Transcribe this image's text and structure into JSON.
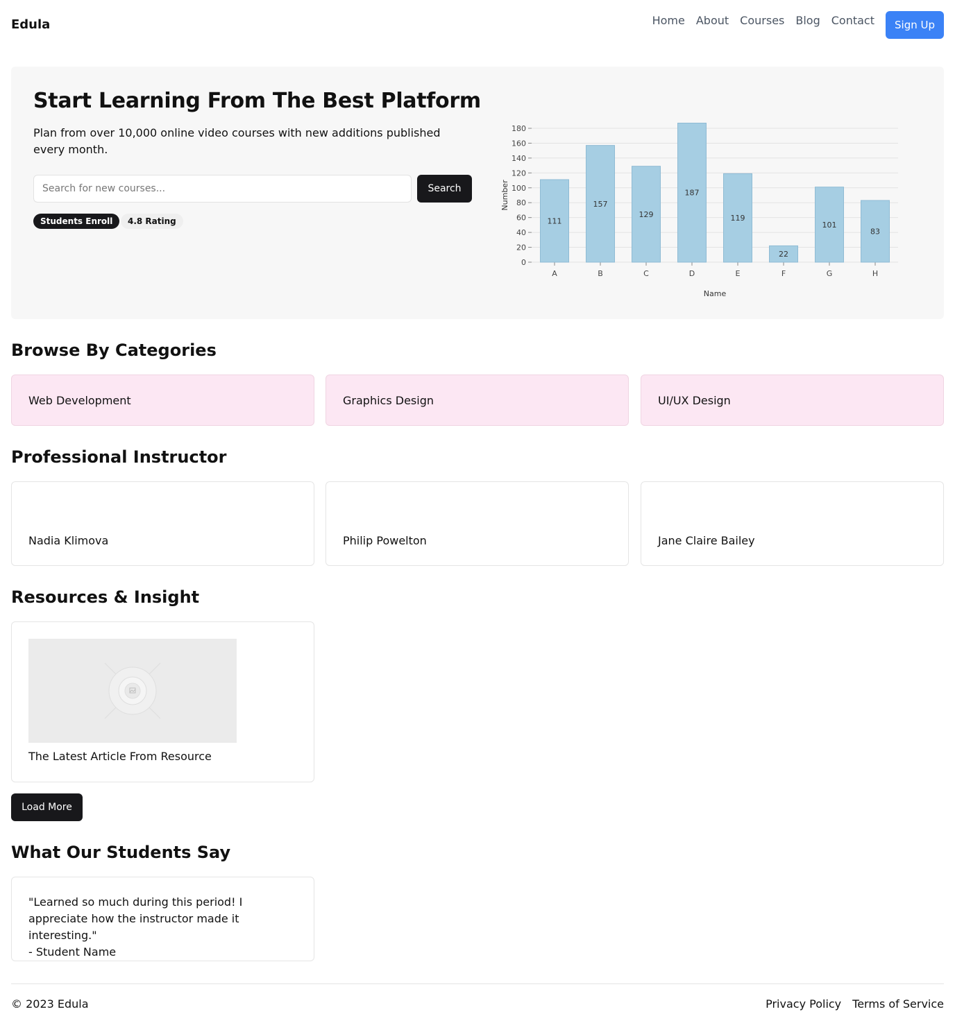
{
  "brand": "Edula",
  "nav": {
    "items": [
      "Home",
      "About",
      "Courses",
      "Blog",
      "Contact"
    ],
    "signup_label": "Sign Up",
    "signup_color": "#3b82f6"
  },
  "hero": {
    "title": "Start Learning From The Best Platform",
    "subtitle": "Plan from over 10,000 online video courses with new additions published every month.",
    "search_placeholder": "Search for new courses...",
    "search_label": "Search",
    "badges": [
      "Students Enroll",
      "4.8 Rating"
    ]
  },
  "chart_data": {
    "type": "bar",
    "categories": [
      "A",
      "B",
      "C",
      "D",
      "E",
      "F",
      "G",
      "H"
    ],
    "values": [
      111,
      157,
      129,
      187,
      119,
      22,
      101,
      83
    ],
    "xlabel": "Name",
    "ylabel": "Number",
    "ylim": [
      0,
      180
    ],
    "yticks": [
      0,
      20,
      40,
      60,
      80,
      100,
      120,
      140,
      160,
      180
    ],
    "grid": true,
    "bar_color": "#a6cee3"
  },
  "categories": {
    "title": "Browse By Categories",
    "items": [
      "Web Development",
      "Graphics Design",
      "UI/UX Design"
    ]
  },
  "instructors": {
    "title": "Professional Instructor",
    "items": [
      "Nadia Klimova",
      "Philip Powelton",
      "Jane Claire Bailey"
    ]
  },
  "resources": {
    "title": "Resources & Insight",
    "article_title": "The Latest Article From Resource",
    "load_more_label": "Load More"
  },
  "testimonials": {
    "title": "What Our Students Say",
    "quote": "\"Learned so much during this period! I appreciate how the instructor made it interesting.\"",
    "author": "- Student Name"
  },
  "footer": {
    "copyright": "© 2023 Edula",
    "links": [
      "Privacy Policy",
      "Terms of Service"
    ]
  }
}
